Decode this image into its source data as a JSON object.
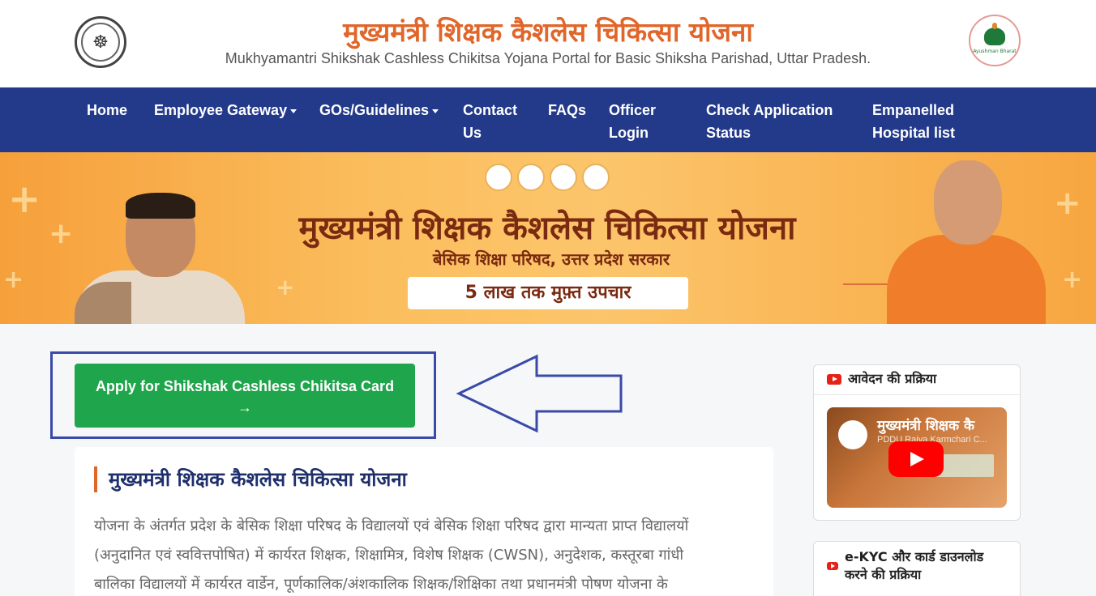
{
  "header": {
    "title": "मुख्यमंत्री शिक्षक कैशलेस चिकित्सा योजना",
    "subtitle": "Mukhyamantri Shikshak Cashless Chikitsa Yojana Portal for Basic Shiksha Parishad, Uttar Pradesh.",
    "right_logo_caption": "Ayushman Bharat"
  },
  "nav": {
    "items": [
      {
        "label": "Home"
      },
      {
        "label": "Employee Gateway",
        "dropdown": true
      },
      {
        "label": "GOs/Guidelines",
        "dropdown": true
      },
      {
        "label": "Contact Us"
      },
      {
        "label": "FAQs"
      },
      {
        "label": "Officer Login"
      },
      {
        "label": "Check Application Status"
      },
      {
        "label": "Empanelled Hospital list"
      }
    ]
  },
  "banner": {
    "title": "मुख्यमंत्री शिक्षक कैशलेस चिकित्सा योजना",
    "subtitle": "बेसिक शिक्षा परिषद, उत्तर प्रदेश सरकार",
    "pill": "5 लाख तक मुफ़्त उपचार"
  },
  "cta": {
    "label": "Apply for Shikshak Cashless Chikitsa Card",
    "arrow": "→"
  },
  "content": {
    "title": "मुख्यमंत्री शिक्षक कैशलेस चिकित्सा योजना",
    "lines": [
      "योजना के अंतर्गत प्रदेश के बेसिक शिक्षा परिषद के विद्यालयों एवं बेसिक शिक्षा परिषद द्वारा मान्यता प्राप्त विद्यालयों",
      "(अनुदानित एवं स्ववित्तपोषित) में कार्यरत शिक्षक, शिक्षामित्र, विशेष शिक्षक (CWSN), अनुदेशक, कस्तूरबा गांधी",
      "बालिका विद्यालयों में कार्यरत वार्डेन, पूर्णकालिक/अंशकालिक शिक्षक/शिक्षिका तथा प्रधानमंत्री पोषण योजना के"
    ]
  },
  "sidebar": {
    "process_title": "आवेदन की प्रक्रिया",
    "video_title": "मुख्यमंत्री शिक्षक कै",
    "video_channel": "PDDU Rajya Karmchari C...",
    "ekyc_title": "e-KYC और कार्ड डाउनलोड करने की प्रक्रिया"
  },
  "colors": {
    "nav_bg": "#233a8b",
    "accent_orange": "#e0662a",
    "cta_green": "#1fa54b",
    "highlight_box": "#3a4aa8"
  }
}
